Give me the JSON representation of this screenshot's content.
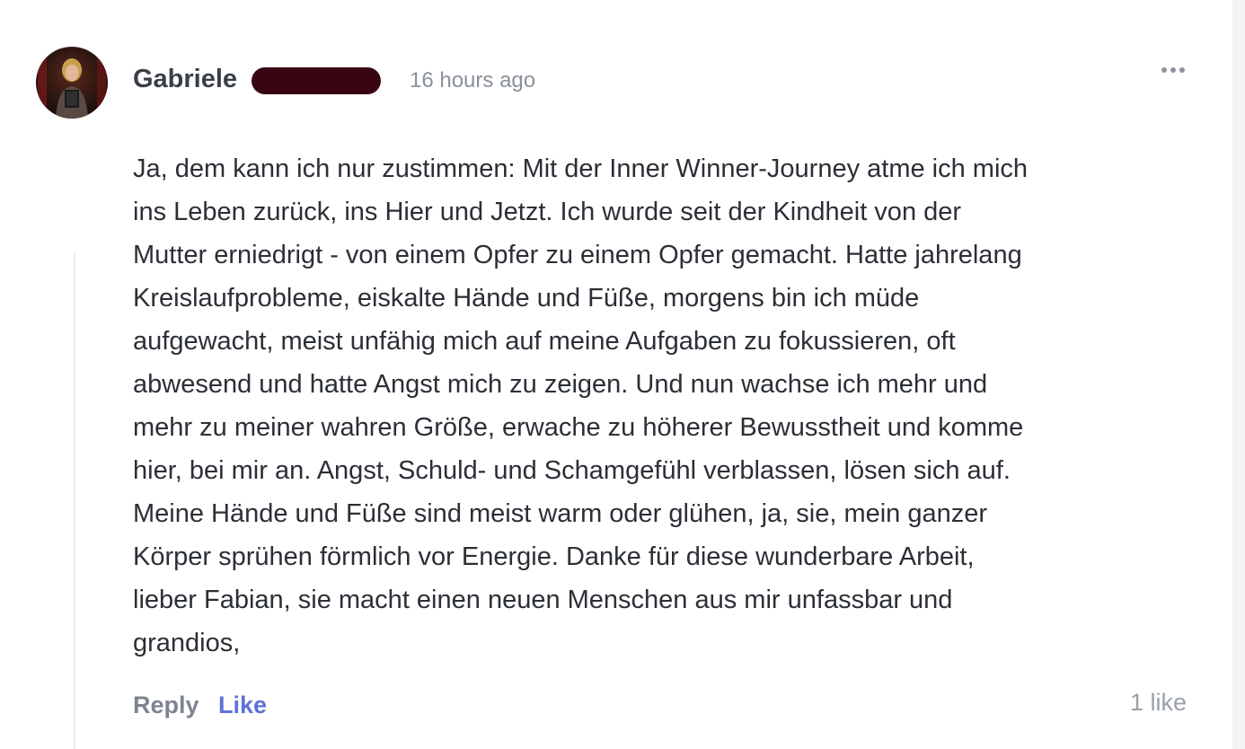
{
  "comment": {
    "author": {
      "name": "Gabriele",
      "avatar_icon": "user-avatar-photo"
    },
    "timestamp": "16 hours ago",
    "menu_icon": "more-horizontal-icon",
    "body_lines": [
      "Ja, dem kann ich nur zustimmen: Mit der Inner Winner-Journey atme ich mich",
      "ins Leben zurück, ins Hier und Jetzt. Ich wurde seit der Kindheit von der",
      "Mutter erniedrigt - von einem Opfer zu einem Opfer gemacht. Hatte jahrelang",
      "Kreislaufprobleme, eiskalte Hände und Füße, morgens bin ich müde",
      "aufgewacht, meist unfähig mich auf meine Aufgaben zu fokussieren, oft",
      "abwesend und hatte Angst mich zu zeigen. Und nun wachse ich mehr und",
      "mehr zu meiner wahren Größe, erwache zu höherer Bewusstheit und komme",
      "hier, bei mir an. Angst, Schuld- und Schamgefühl verblassen, lösen sich auf.",
      "Meine Hände und Füße sind meist warm oder glühen, ja, sie, mein ganzer",
      "Körper sprühen förmlich vor Energie. Danke für diese wunderbare Arbeit,",
      "lieber Fabian, sie macht einen neuen Menschen aus mir unfassbar und",
      "grandios,"
    ],
    "actions": {
      "reply_label": "Reply",
      "like_label": "Like"
    },
    "like_count": "1 like"
  },
  "colors": {
    "text": "#2b2f36",
    "muted": "#8a919b",
    "like_accent": "#5f72d8",
    "redaction": "#3a0512"
  }
}
